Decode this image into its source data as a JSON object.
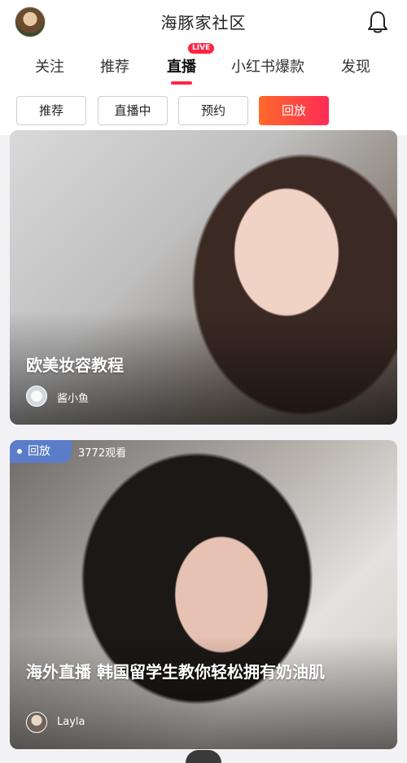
{
  "header": {
    "title": "海豚家社区",
    "icons": {
      "avatar": "user-avatar",
      "bell": "bell-icon"
    }
  },
  "tabs": [
    {
      "label": "关注",
      "active": false
    },
    {
      "label": "推荐",
      "active": false
    },
    {
      "label": "直播",
      "active": true,
      "badge": "LIVE"
    },
    {
      "label": "小红书爆款",
      "active": false
    },
    {
      "label": "发现",
      "active": false
    }
  ],
  "filters": [
    {
      "label": "推荐",
      "selected": false
    },
    {
      "label": "直播中",
      "selected": false
    },
    {
      "label": "预约",
      "selected": false
    },
    {
      "label": "回放",
      "selected": true
    }
  ],
  "cards": [
    {
      "title": "欧美妆容教程",
      "author": "酱小鱼"
    },
    {
      "badge": "回放",
      "views": "3772观看",
      "title": "海外直播 韩国留学生教你轻松拥有奶油肌",
      "author": "Layla"
    }
  ],
  "colors": {
    "accent": "#ff2442",
    "chip_gradient_start": "#ff6a2a",
    "chip_gradient_end": "#ff2a55",
    "replay_badge": "#5b7dc9"
  }
}
